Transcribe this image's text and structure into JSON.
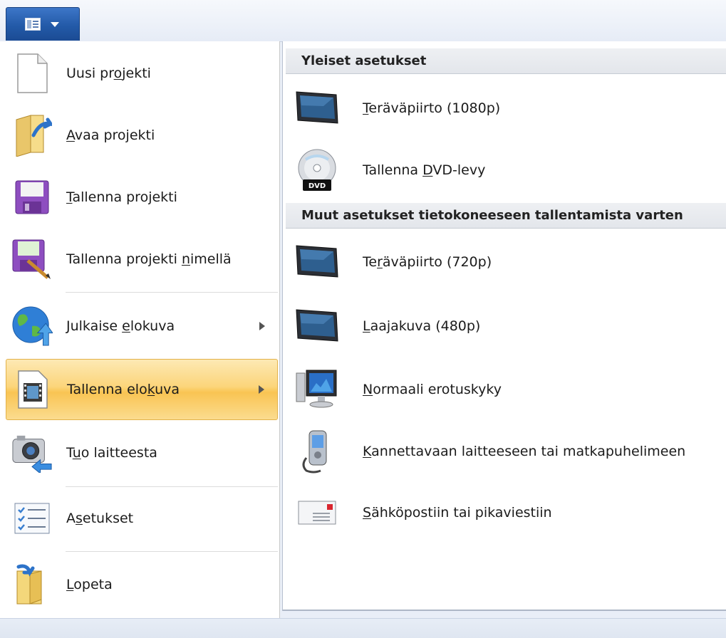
{
  "colors": {
    "accent": "#235aa8",
    "selected_highlight": "#f9c453"
  },
  "app_button": {
    "icon": "app-menu-icon"
  },
  "menu": {
    "items": [
      {
        "name": "menu-item-new-project",
        "icon": "new-document-icon",
        "pre": "Uusi pr",
        "key": "o",
        "post": "jekti",
        "has_submenu": false
      },
      {
        "name": "menu-item-open-project",
        "icon": "open-folder-icon",
        "pre": "",
        "key": "A",
        "post": "vaa projekti",
        "has_submenu": false
      },
      {
        "name": "menu-item-save-project",
        "icon": "save-disk-icon",
        "pre": "",
        "key": "T",
        "post": "allenna projekti",
        "has_submenu": false
      },
      {
        "name": "menu-item-save-project-as",
        "icon": "save-as-icon",
        "pre": "Tallenna projekti ",
        "key": "n",
        "post": "imellä",
        "has_submenu": false
      },
      {
        "name": "menu-item-publish-movie",
        "icon": "globe-publish-icon",
        "pre": "Julkaise ",
        "key": "e",
        "post": "lokuva",
        "has_submenu": true
      },
      {
        "name": "menu-item-save-movie",
        "icon": "film-document-icon",
        "pre": "Tallenna elo",
        "key": "k",
        "post": "uva",
        "has_submenu": true,
        "selected": true
      },
      {
        "name": "menu-item-import-from-device",
        "icon": "camera-import-icon",
        "pre": "T",
        "key": "u",
        "post": "o laitteesta",
        "has_submenu": false
      },
      {
        "name": "menu-item-options",
        "icon": "options-checklist-icon",
        "pre": "A",
        "key": "s",
        "post": "etukset",
        "has_submenu": false
      },
      {
        "name": "menu-item-exit",
        "icon": "exit-icon",
        "pre": "",
        "key": "L",
        "post": "opeta",
        "has_submenu": false
      }
    ]
  },
  "submenu": {
    "sections": [
      {
        "header": "Yleiset asetukset"
      },
      {
        "header": "Muut asetukset tietokoneeseen tallentamista varten"
      }
    ],
    "items": [
      {
        "name": "submenu-item-hd-1080p",
        "icon": "monitor-icon",
        "pre": "",
        "key": "T",
        "post": "eräväpiirto (1080p)"
      },
      {
        "name": "submenu-item-burn-dvd",
        "icon": "dvd-disc-icon",
        "pre": "Tallenna ",
        "key": "D",
        "post": "VD-levy"
      },
      {
        "name": "submenu-item-hd-720p",
        "icon": "monitor-icon",
        "pre": "Te",
        "key": "r",
        "post": "äväpiirto (720p)"
      },
      {
        "name": "submenu-item-widescreen-480p",
        "icon": "monitor-icon",
        "pre": "",
        "key": "L",
        "post": "aajakuva (480p)"
      },
      {
        "name": "submenu-item-standard-definition",
        "icon": "desktop-computer-icon",
        "pre": "",
        "key": "N",
        "post": "ormaali erotuskyky"
      },
      {
        "name": "submenu-item-portable-device",
        "icon": "mobile-phone-icon",
        "pre": "",
        "key": "K",
        "post": "annettavaan laitteeseen tai matkapuhelimeen"
      },
      {
        "name": "submenu-item-email",
        "icon": "email-icon",
        "pre": "",
        "key": "S",
        "post": "ähköpostiin tai pikaviestiin"
      }
    ]
  }
}
